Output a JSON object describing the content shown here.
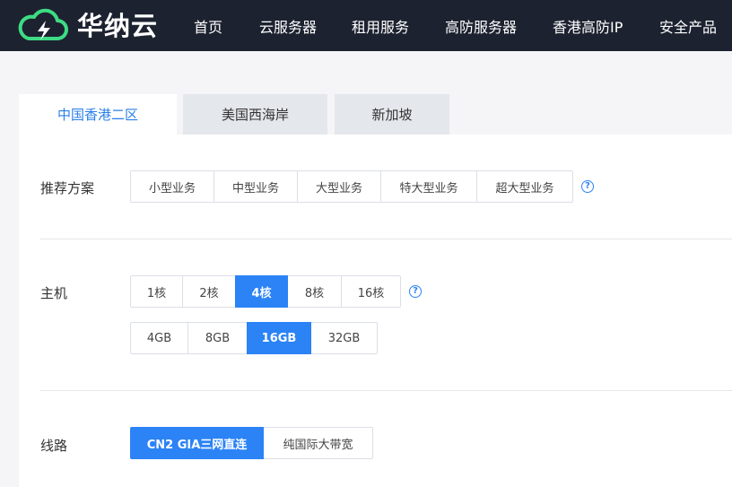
{
  "brand": {
    "name": "华纳云",
    "logo_icon": "cloud-lightning-icon",
    "colors": {
      "header_bg": "#1d2230",
      "accent": "#2b83f6",
      "logo_green": "#3ddc84"
    }
  },
  "nav": {
    "items": [
      "首页",
      "云服务器",
      "租用服务",
      "高防服务器",
      "香港高防IP",
      "安全产品"
    ]
  },
  "tabs": {
    "items": [
      "中国香港二区",
      "美国西海岸",
      "新加坡"
    ],
    "active": "中国香港二区"
  },
  "plans": {
    "label": "推荐方案",
    "options": [
      "小型业务",
      "中型业务",
      "大型业务",
      "特大型业务",
      "超大型业务"
    ],
    "help_icon": "question-circle-icon",
    "help_glyph": "?"
  },
  "host": {
    "label": "主机",
    "cpu_options": [
      "1核",
      "2核",
      "4核",
      "8核",
      "16核"
    ],
    "cpu_selected": "4核",
    "ram_options": [
      "4GB",
      "8GB",
      "16GB",
      "32GB"
    ],
    "ram_selected": "16GB",
    "help_icon": "question-circle-icon",
    "help_glyph": "?"
  },
  "line": {
    "label": "线路",
    "options": [
      "CN2 GIA三网直连",
      "纯国际大带宽"
    ],
    "selected": "CN2 GIA三网直连"
  }
}
